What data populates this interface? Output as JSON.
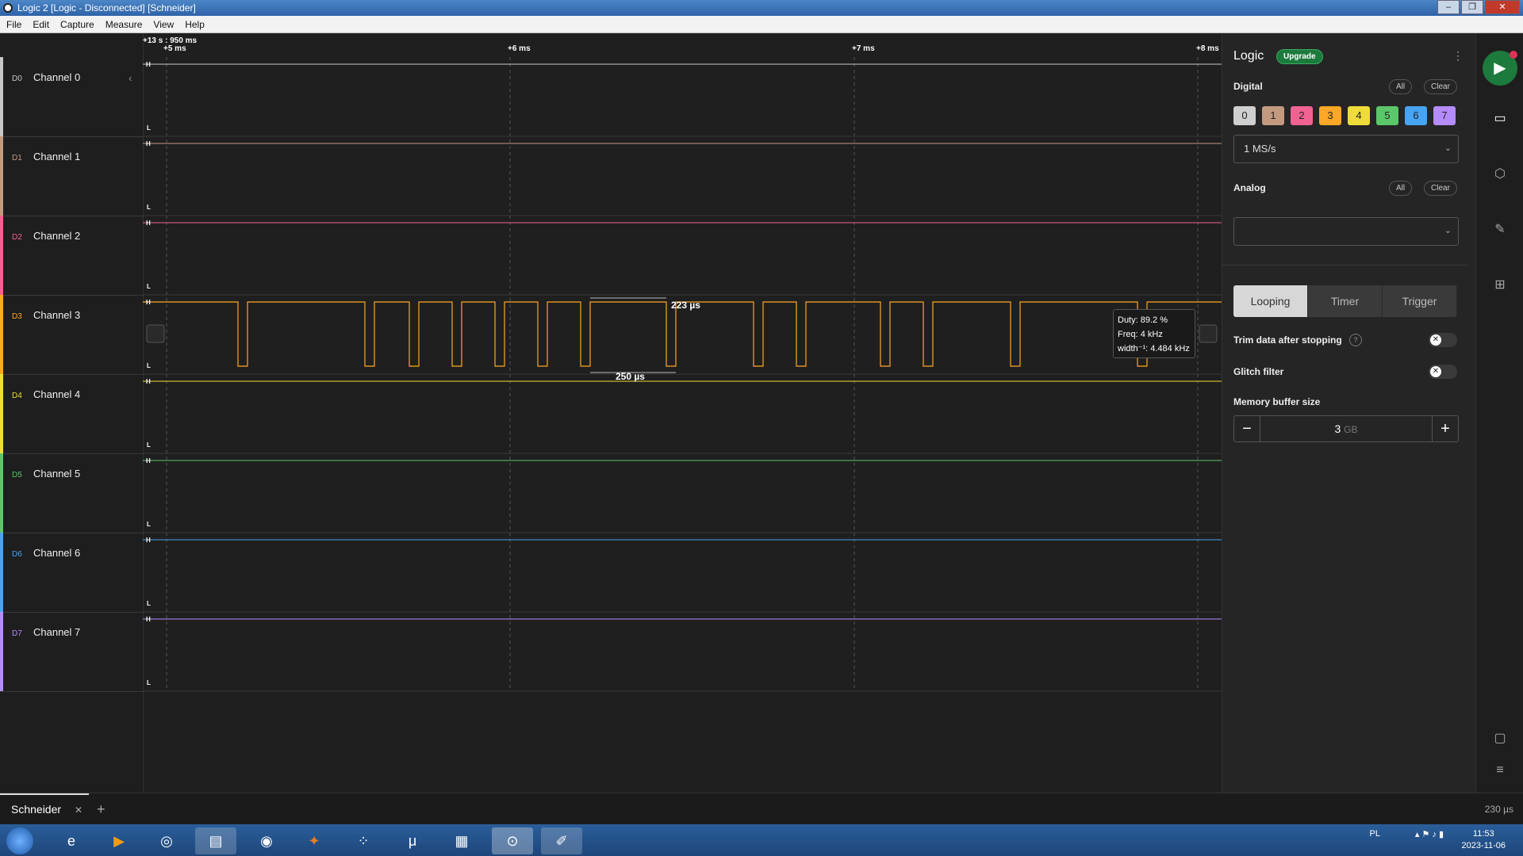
{
  "window": {
    "title": "Logic 2 [Logic - Disconnected] [Schneider]"
  },
  "menu": [
    "File",
    "Edit",
    "Capture",
    "Measure",
    "View",
    "Help"
  ],
  "timeline": {
    "origin": "+13 s : 950 ms",
    "ticks": [
      "+5 ms",
      "+6 ms",
      "+7 ms",
      "+8 ms"
    ]
  },
  "channels": [
    {
      "tag": "D0",
      "name": "Channel 0",
      "color": "#c8c8c8"
    },
    {
      "tag": "D1",
      "name": "Channel 1",
      "color": "#c49a7f"
    },
    {
      "tag": "D2",
      "name": "Channel 2",
      "color": "#f06292"
    },
    {
      "tag": "D3",
      "name": "Channel 3",
      "color": "#ffa726"
    },
    {
      "tag": "D4",
      "name": "Channel 4",
      "color": "#eedc3a"
    },
    {
      "tag": "D5",
      "name": "Channel 5",
      "color": "#5cc76a"
    },
    {
      "tag": "D6",
      "name": "Channel 6",
      "color": "#47a3f3"
    },
    {
      "tag": "D7",
      "name": "Channel 7",
      "color": "#b58cff"
    }
  ],
  "levels": {
    "high": "H",
    "low": "L"
  },
  "measurements": {
    "pulse_width": "223 µs",
    "period": "250 µs",
    "tooltip": {
      "duty": "Duty: 89.2 %",
      "freq": "Freq: 4 kHz",
      "width_inv": "width⁻¹: 4.484 kHz"
    }
  },
  "panel": {
    "title": "Logic",
    "upgrade": "Upgrade",
    "digital": "Digital",
    "analog": "Analog",
    "all": "All",
    "clear": "Clear",
    "digital_channels": [
      "0",
      "1",
      "2",
      "3",
      "4",
      "5",
      "6",
      "7"
    ],
    "sample_rate": "1 MS/s",
    "modes": [
      "Looping",
      "Timer",
      "Trigger"
    ],
    "trim": "Trim data after stopping",
    "glitch": "Glitch filter",
    "memory_label": "Memory buffer size",
    "memory_value": "3",
    "memory_unit": "GB"
  },
  "bottom": {
    "tab": "Schneider",
    "zoom": "230 µs"
  },
  "taskbar": {
    "lang": "PL",
    "time": "11:53",
    "date": "2023-11-06"
  }
}
